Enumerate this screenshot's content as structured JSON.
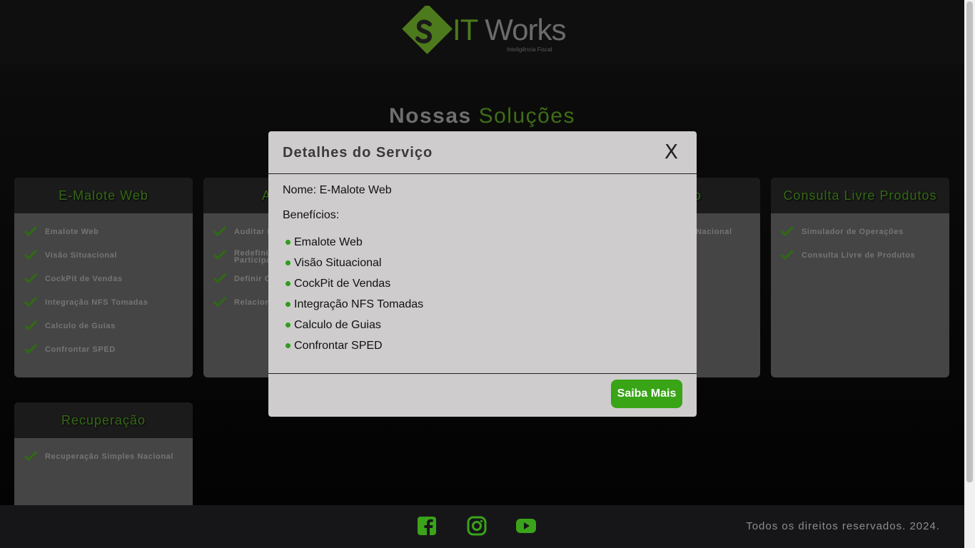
{
  "header": {
    "logo_text_it": "IT",
    "logo_text_works": " Works",
    "logo_tagline": "Inteligência Fiscal"
  },
  "section": {
    "title_primary": "Nossas",
    "title_accent": "Soluções"
  },
  "cards": [
    {
      "title": "E-Malote Web",
      "items": [
        "Emalote Web",
        "Visão Situacional",
        "CockPit de Vendas",
        "Integração NFS Tomadas",
        "Calculo de Guias",
        "Confrontar SPED"
      ]
    },
    {
      "title": "A",
      "items": [
        "Auditar D",
        "Redefini",
        "Participa",
        "Definir C",
        "Relacion"
      ]
    },
    {
      "title": "ão",
      "items": [
        "Nacional"
      ]
    },
    {
      "title": "Consulta Livre Produtos",
      "items": [
        "Simulador de Operações",
        "Consulta Livre de Produtos"
      ]
    },
    {
      "title": "Recuperação",
      "items": [
        "Recuperação Simples Nacional"
      ]
    }
  ],
  "modal": {
    "title": "Detalhes do Serviço",
    "close_label": "X",
    "name_line": "Nome: E-Malote Web",
    "benefits_label": "Benefícios:",
    "benefits": [
      "Emalote Web",
      "Visão Situacional",
      "CockPit de Vendas",
      "Integração NFS Tomadas",
      "Calculo de Guias",
      "Confrontar SPED"
    ],
    "cta_label": "Saiba Mais"
  },
  "footer": {
    "social": [
      "facebook-icon",
      "instagram-icon",
      "youtube-icon"
    ],
    "copyright": "Todos os direitos reservados. 2024."
  },
  "colors": {
    "accent": "#38a416",
    "brand_green": "#4d7a1c",
    "modal_bg": "#cecccd"
  }
}
